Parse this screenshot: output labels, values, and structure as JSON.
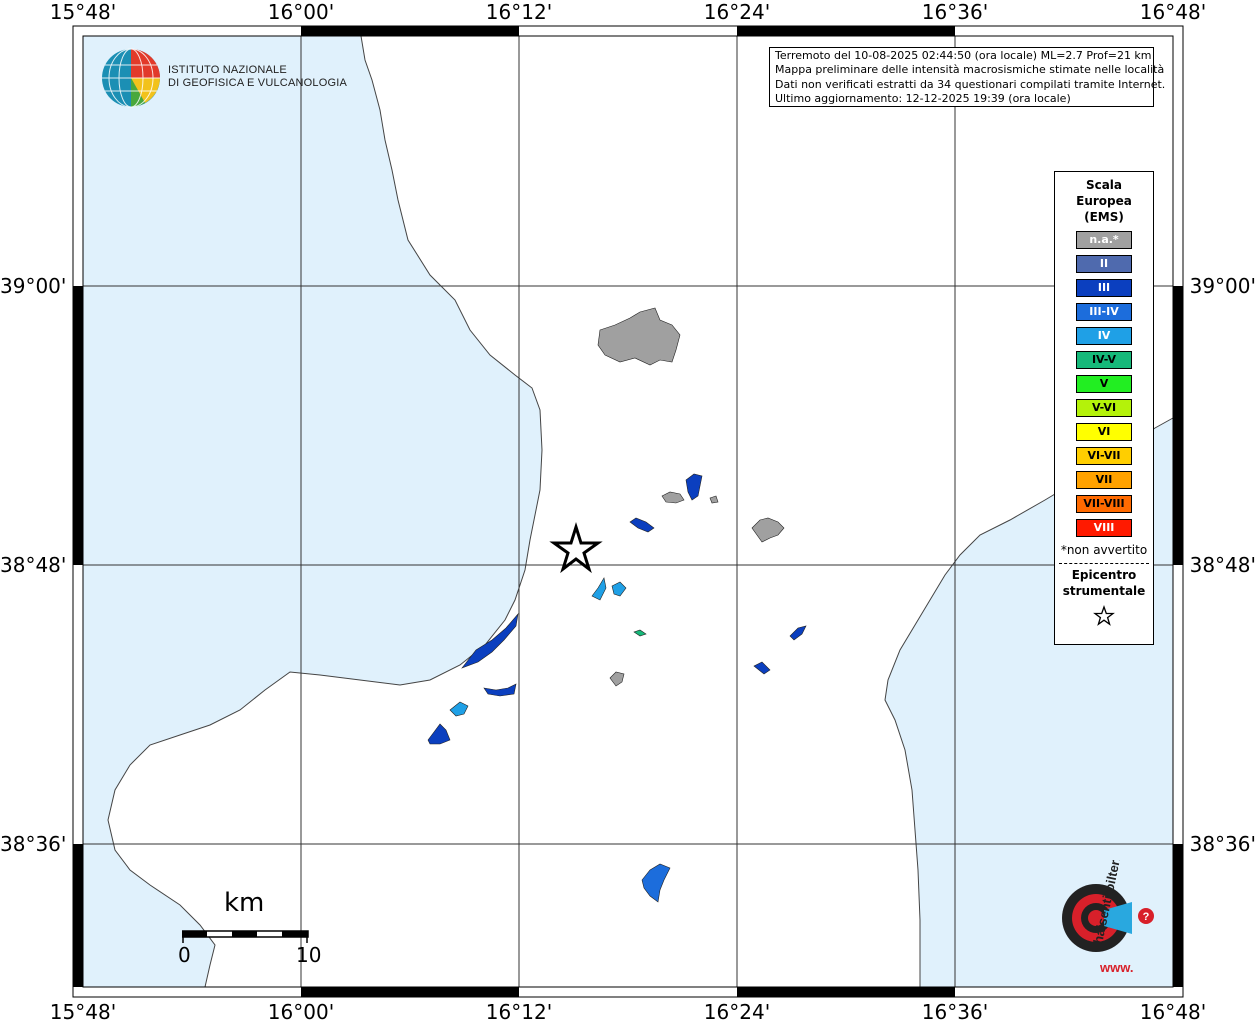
{
  "map": {
    "lon_ticks_top": [
      "15°48'",
      "16°00'",
      "16°12'",
      "16°24'",
      "16°36'",
      "16°48'"
    ],
    "lon_ticks_bottom": [
      "15°48'",
      "16°00'",
      "16°12'",
      "16°24'",
      "16°36'",
      "16°48'"
    ],
    "lat_ticks_left": [
      "39°00'",
      "38°48'",
      "38°36'"
    ],
    "lat_ticks_right": [
      "39°00'",
      "38°48'",
      "38°36'"
    ],
    "sea_color": "#e0f1fc",
    "land_color": "#ffffff",
    "na_color": "#a0a0a0"
  },
  "info": {
    "line1": "Terremoto del 10-08-2025 02:44:50 (ora locale) ML=2.7 Prof=21 km",
    "line2": "Mappa preliminare delle intensità macrosismiche stimate nelle località",
    "line3": "Dati non verificati estratti da 34 questionari compilati tramite Internet.",
    "line4": "Ultimo aggiornamento: 12-12-2025 19:39 (ora locale)"
  },
  "legend": {
    "title_line1": "Scala",
    "title_line2": "Europea",
    "title_line3": "(EMS)",
    "items": [
      {
        "label": "n.a.*",
        "color": "#a0a0a0",
        "text_color": "#ffffff"
      },
      {
        "label": "II",
        "color": "#4f6aae",
        "text_color": "#ffffff"
      },
      {
        "label": "III",
        "color": "#0b3fbf",
        "text_color": "#ffffff"
      },
      {
        "label": "III-IV",
        "color": "#1c6ddc",
        "text_color": "#ffffff"
      },
      {
        "label": "IV",
        "color": "#1fa0e6",
        "text_color": "#ffffff"
      },
      {
        "label": "IV-V",
        "color": "#16b97a",
        "text_color": "#000000"
      },
      {
        "label": "V",
        "color": "#22ee22",
        "text_color": "#000000"
      },
      {
        "label": "V-VI",
        "color": "#b4f20a",
        "text_color": "#000000"
      },
      {
        "label": "VI",
        "color": "#ffff00",
        "text_color": "#000000"
      },
      {
        "label": "VI-VII",
        "color": "#ffce00",
        "text_color": "#000000"
      },
      {
        "label": "VII",
        "color": "#ffa200",
        "text_color": "#000000"
      },
      {
        "label": "VII-VIII",
        "color": "#ff6a00",
        "text_color": "#000000"
      },
      {
        "label": "VIII",
        "color": "#ff1a00",
        "text_color": "#ffffff"
      }
    ],
    "note": "*non avvertito",
    "epicenter_line1": "Epicentro",
    "epicenter_line2": "strumentale"
  },
  "logo": {
    "line1": "ISTITUTO NAZIONALE",
    "line2": "DI GEOFISICA E VULCANOLOGIA"
  },
  "scale": {
    "unit": "km",
    "min": "0",
    "max": "10"
  },
  "hsit_logo": {
    "text": "haisentitoilterremoto.it",
    "www": "www."
  }
}
